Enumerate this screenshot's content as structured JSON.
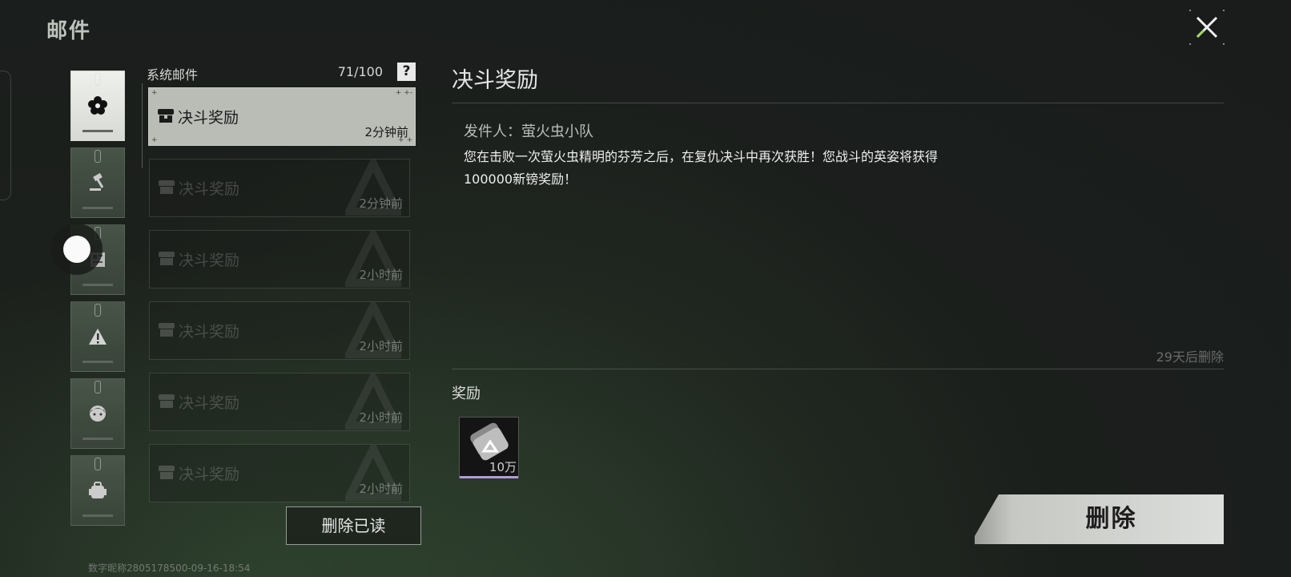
{
  "page": {
    "title": "邮件",
    "footer_id": "数字昵称2805178500-09-16-18:54"
  },
  "categories": [
    {
      "name": "system",
      "icon": "flower-icon",
      "active": true
    },
    {
      "name": "duel",
      "icon": "gavel-icon",
      "active": false
    },
    {
      "name": "news",
      "icon": "newspaper-icon",
      "active": false
    },
    {
      "name": "alert",
      "icon": "warning-icon",
      "active": false
    },
    {
      "name": "character",
      "icon": "girl-face-icon",
      "active": false
    },
    {
      "name": "item",
      "icon": "backpack-icon",
      "active": false
    }
  ],
  "mail_list": {
    "header_label": "系统邮件",
    "count": "71/100",
    "help_label": "?",
    "items": [
      {
        "title": "决斗奖励",
        "time": "2分钟前",
        "selected": true
      },
      {
        "title": "决斗奖励",
        "time": "2分钟前",
        "selected": false
      },
      {
        "title": "决斗奖励",
        "time": "2小时前",
        "selected": false
      },
      {
        "title": "决斗奖励",
        "time": "2小时前",
        "selected": false
      },
      {
        "title": "决斗奖励",
        "time": "2小时前",
        "selected": false
      },
      {
        "title": "决斗奖励",
        "time": "2小时前",
        "selected": false
      }
    ],
    "delete_read_label": "删除已读"
  },
  "detail": {
    "title": "决斗奖励",
    "sender": "发件人：萤火虫小队",
    "body_line1": "您在击败一次萤火虫精明的芬芳之后，在复仇决斗中再次获胜！您战斗的英姿将获得",
    "body_line2": "100000新镑奖励！",
    "expire": "29天后删除",
    "reward_label": "奖励",
    "reward": {
      "icon": "currency-icon",
      "quantity": "10万",
      "rarity_color": "#b39bd6"
    },
    "delete_label": "删除"
  },
  "colors": {
    "background": "#1c201c",
    "selected_item": "#b9bdb6",
    "accent_green": "#a4d65e"
  }
}
